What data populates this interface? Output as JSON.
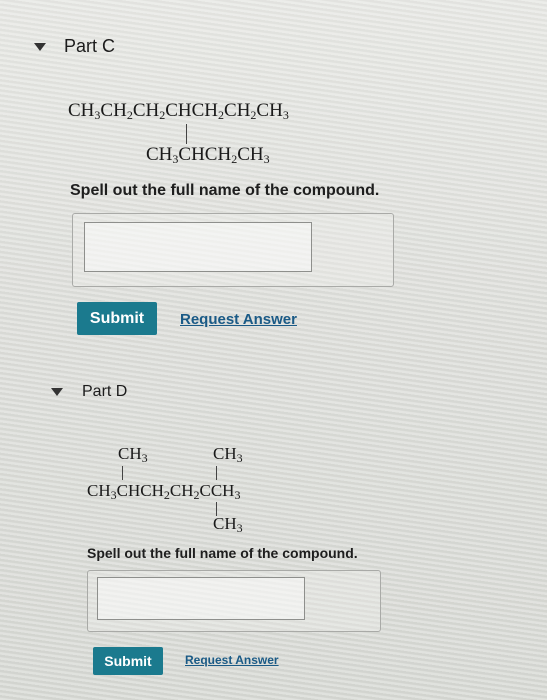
{
  "part_c": {
    "title": "Part C",
    "formula_main": [
      "CH",
      "3",
      "CH",
      "2",
      "CH",
      "2",
      "CHCH",
      "2",
      "CH",
      "2",
      "CH",
      "3"
    ],
    "formula_branch": [
      "CH",
      "3",
      "CHCH",
      "2",
      "CH",
      "3"
    ],
    "question": "Spell out the full name of the compound.",
    "answer_value": "",
    "submit_label": "Submit",
    "request_label": "Request Answer"
  },
  "part_d": {
    "title": "Part D",
    "top_left_group": [
      "CH",
      "3"
    ],
    "top_right_group": [
      "CH",
      "3"
    ],
    "formula_main": [
      "CH",
      "3",
      "CHCH",
      "2",
      "CH",
      "2",
      "CCH",
      "3"
    ],
    "bottom_group": [
      "CH",
      "3"
    ],
    "question": "Spell out the full name of the compound.",
    "answer_value": "",
    "submit_label": "Submit",
    "request_label": "Request Answer"
  },
  "colors": {
    "submit_bg": "#1b7a8e",
    "link": "#1a5a86"
  }
}
